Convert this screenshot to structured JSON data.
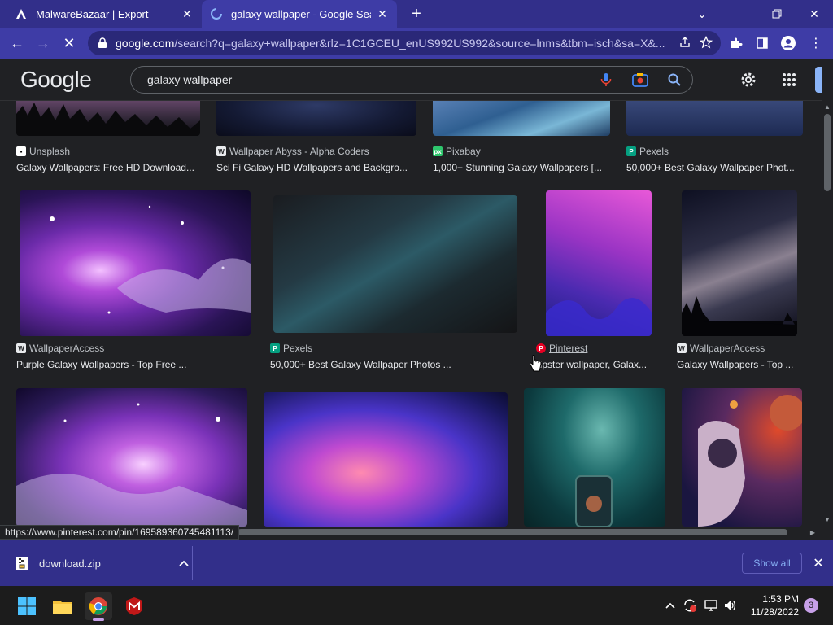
{
  "browser": {
    "tabs": [
      {
        "title": "MalwareBazaar | Export",
        "favicon": "malwarebazaar-icon"
      },
      {
        "title": "galaxy wallpaper - Google Search",
        "favicon": "loading-spinner-icon"
      }
    ],
    "url_host": "google.com",
    "url_rest": "/search?q=galaxy+wallpaper&rlz=1C1GCEU_enUS992US992&source=lnms&tbm=isch&sa=X&...",
    "colors": {
      "frame": "#322f8a",
      "active_tab": "#3e3ca6",
      "omnibox": "#2a2878"
    }
  },
  "google": {
    "logo": "Google",
    "query": "galaxy wallpaper"
  },
  "results": {
    "row1": [
      {
        "source": "Unsplash",
        "caption": "Galaxy Wallpapers: Free HD Download..."
      },
      {
        "source": "Wallpaper Abyss - Alpha Coders",
        "caption": "Sci Fi Galaxy HD Wallpapers and Backgro..."
      },
      {
        "source": "Pixabay",
        "caption": "1,000+ Stunning Galaxy Wallpapers [..."
      },
      {
        "source": "Pexels",
        "caption": "50,000+ Best Galaxy Wallpaper Phot..."
      }
    ],
    "row2": [
      {
        "source": "WallpaperAccess",
        "caption": "Purple Galaxy Wallpapers - Top Free ..."
      },
      {
        "source": "Pexels",
        "caption": "50,000+ Best Galaxy Wallpaper Photos ..."
      },
      {
        "source": "Pinterest",
        "caption": "Hipster wallpaper, Galax..."
      },
      {
        "source": "WallpaperAccess",
        "caption": "Galaxy Wallpapers - Top ..."
      }
    ]
  },
  "status_bar": {
    "link_url": "https://www.pinterest.com/pin/169589360745481113/"
  },
  "downloads": {
    "file_name": "download.zip",
    "show_all": "Show all"
  },
  "taskbar": {
    "time": "1:53 PM",
    "date": "11/28/2022",
    "notification_count": "3"
  }
}
